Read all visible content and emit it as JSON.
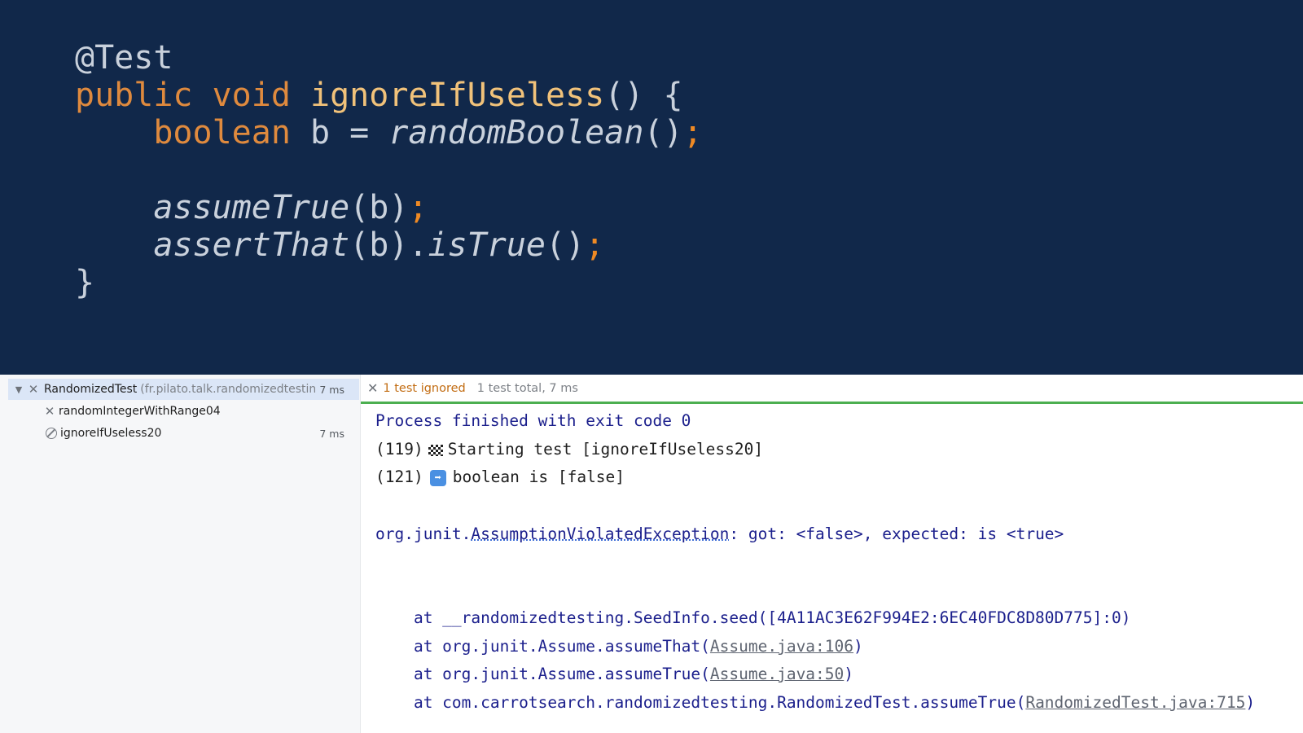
{
  "code": {
    "annotation": "@Test",
    "line2": {
      "kw_public": "public",
      "kw_void": "void",
      "method": "ignoreIfUseless",
      "rest": "() {"
    },
    "line3": {
      "kw_boolean": "boolean",
      "var_assign": " b = ",
      "call": "randomBoolean",
      "parens": "()",
      "semi": ";"
    },
    "line5": {
      "call": "assumeTrue",
      "args": "(b)",
      "semi": ";"
    },
    "line6": {
      "call": "assertThat",
      "args": "(b).",
      "call2": "isTrue",
      "parens": "()",
      "semi": ";"
    },
    "line7": "}"
  },
  "tree": {
    "root": {
      "label": "RandomizedTest",
      "package": "(fr.pilato.talk.randomizedtestin",
      "time": "7 ms"
    },
    "items": [
      {
        "label": "randomIntegerWithRange04",
        "time": ""
      },
      {
        "label": "ignoreIfUseless20",
        "time": "7 ms"
      }
    ]
  },
  "status": {
    "ignored": "1 test ignored",
    "total": "1 test total, 7 ms"
  },
  "console": {
    "process": "Process finished with exit code 0",
    "l119_prefix": "(119)",
    "l119_text": "Starting test [ignoreIfUseless20]",
    "l121_prefix": "(121)",
    "l121_text": "boolean is [false]",
    "exc_pkg": "org.junit.",
    "exc_name": "AssumptionViolatedException",
    "exc_msg": ": got: <false>, expected: is <true>",
    "st1": "    at __randomizedtesting.SeedInfo.seed([4A11AC3E62F994E2:6EC40FDC8D80D775]:0)",
    "st2_pre": "    at org.junit.Assume.assumeThat(",
    "st2_link": "Assume.java:106",
    "st3_pre": "    at org.junit.Assume.assumeTrue(",
    "st3_link": "Assume.java:50",
    "st4_pre": "    at com.carrotsearch.randomizedtesting.RandomizedTest.assumeTrue(",
    "st4_link": "RandomizedTest.java:715",
    "close_paren": ")"
  }
}
